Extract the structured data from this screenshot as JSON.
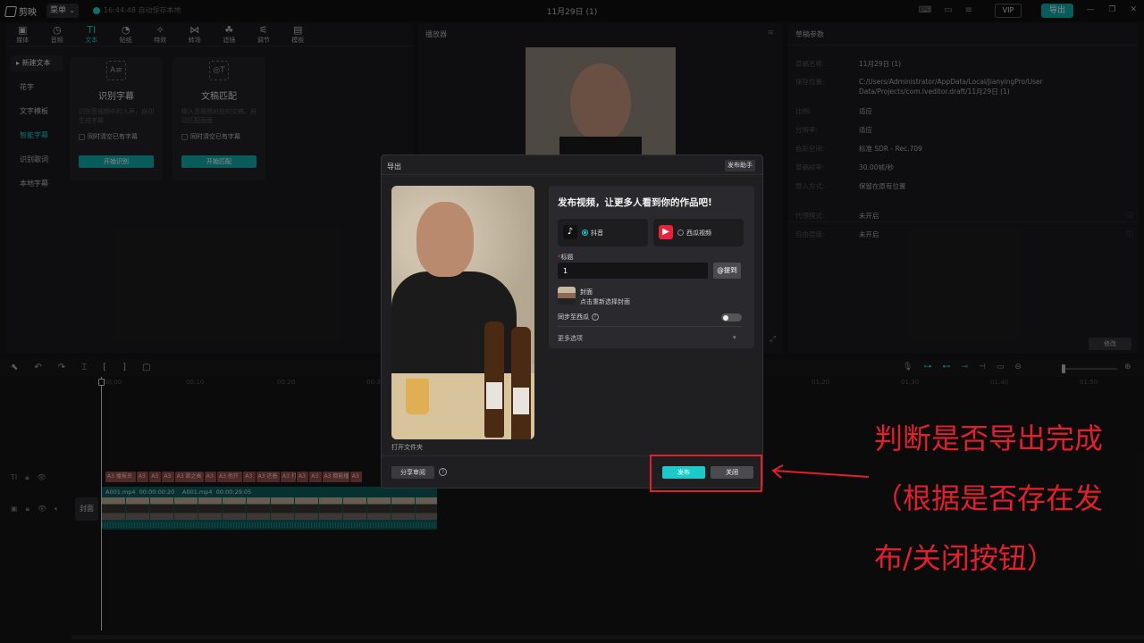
{
  "titlebar": {
    "app_name": "剪映",
    "menu_label": "菜单",
    "autosave": "16:44:48 自动保存本地",
    "doc_title": "11月29日 (1)",
    "vip_label": "VIP",
    "export_label": "导出"
  },
  "toolbar": {
    "tabs": [
      {
        "label": "媒体",
        "icon": "▣"
      },
      {
        "label": "音频",
        "icon": "◷"
      },
      {
        "label": "文本",
        "icon": "TI"
      },
      {
        "label": "贴纸",
        "icon": "◔"
      },
      {
        "label": "特效",
        "icon": "✧"
      },
      {
        "label": "转场",
        "icon": "⋈"
      },
      {
        "label": "滤镜",
        "icon": "☘"
      },
      {
        "label": "调节",
        "icon": "⚟"
      },
      {
        "label": "模板",
        "icon": "▤"
      }
    ]
  },
  "sidebar": {
    "items": [
      "新建文本",
      "花字",
      "文字模板",
      "智能字幕",
      "识别歌词",
      "本地字幕"
    ]
  },
  "cards": [
    {
      "title": "识别字幕",
      "desc": "识别音视频中的人声，自动生成字幕",
      "check": "同时清空已有字幕",
      "button": "开始识别"
    },
    {
      "title": "文稿匹配",
      "desc": "输入音视频对应的文稿，自动匹配画面",
      "check": "同时清空已有字幕",
      "button": "开始匹配"
    }
  ],
  "player": {
    "title": "播放器"
  },
  "params": {
    "title": "草稿参数",
    "rows": [
      {
        "label": "草稿名称:",
        "value": "11月29日 (1)"
      },
      {
        "label": "保存位置:",
        "value": "C:/Users/Administrator/AppData/Local/JianyingPro/User Data/Projects/com.lveditor.draft/11月29日 (1)"
      },
      {
        "label": "比例:",
        "value": "适应"
      },
      {
        "label": "分辨率:",
        "value": "适应"
      },
      {
        "label": "色彩空间:",
        "value": "标准 SDR - Rec.709"
      },
      {
        "label": "草稿帧率:",
        "value": "30.00帧/秒"
      },
      {
        "label": "导入方式:",
        "value": "保留在原有位置"
      },
      {
        "label": "代理模式:",
        "value": "未开启"
      },
      {
        "label": "自由层级:",
        "value": "未开启"
      }
    ],
    "modify_label": "修改"
  },
  "timeline": {
    "ruler": [
      "00:00",
      "00:10",
      "00:20",
      "00:30",
      "01:20",
      "01:30",
      "01:40",
      "01:50"
    ],
    "text_clips": [
      "A3 播报员",
      "A3",
      "A3",
      "A3",
      "A3 歌之高",
      "A3",
      "A3 他开",
      "A3",
      "A3 还着",
      "A3 打",
      "A3",
      "A3",
      "A3 都能播",
      "A3"
    ],
    "video_clips": [
      {
        "name": "A001.mp4",
        "duration": "00:00:00:20"
      },
      {
        "name": "A001.mp4",
        "duration": "00:00:29:05"
      }
    ],
    "cover_label": "封面"
  },
  "dialog": {
    "title": "导出",
    "assistant_label": "发布助手",
    "open_folder": "打开文件夹",
    "publish_heading": "发布视频，让更多人看到你的作品吧!",
    "platforms": [
      {
        "label": "抖音",
        "selected": true
      },
      {
        "label": "西瓜视频",
        "selected": false
      }
    ],
    "title_label": "标题",
    "title_value": "1",
    "mention_label": "@提到",
    "cover_title": "封面",
    "cover_sub": "点击重新选择封面",
    "sync_label": "同步至西瓜",
    "more_options": "更多选项",
    "share_label": "分享审阅",
    "publish_label": "发布",
    "close_label": "关闭"
  },
  "annotation": {
    "text": "判断是否导出完成（根据是否存在发布/关闭按钮）",
    "color": "#e0202c"
  },
  "colors": {
    "accent": "#1dc9c9",
    "annotation": "#e0202c"
  }
}
